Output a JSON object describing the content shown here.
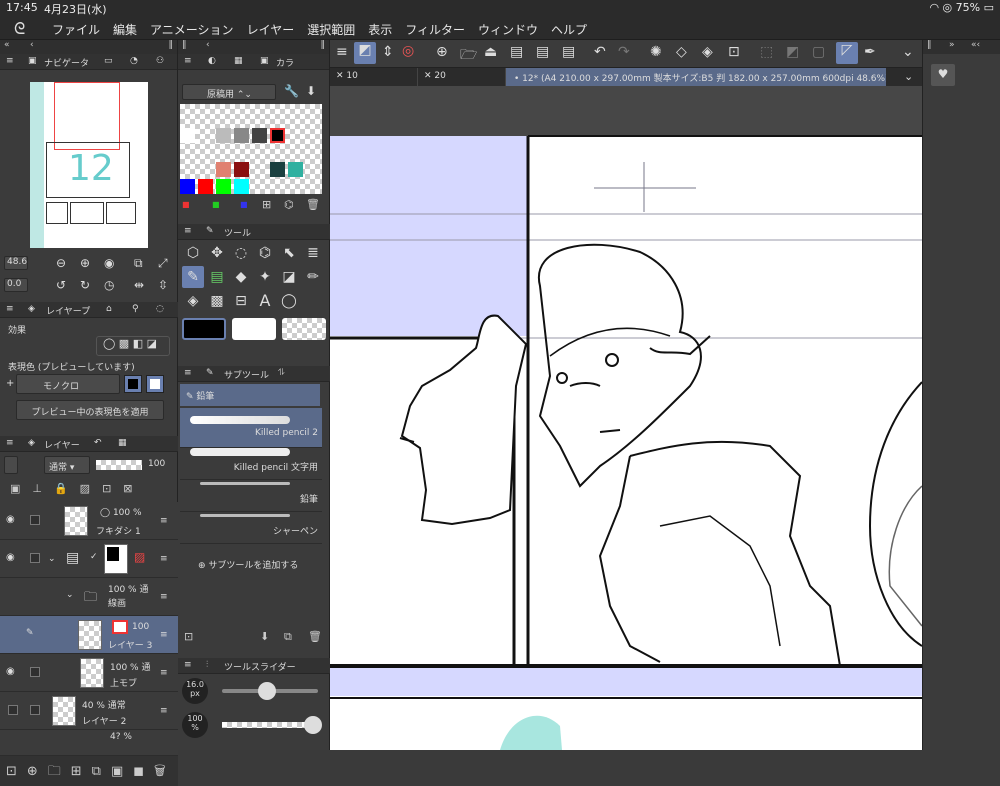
{
  "status": {
    "time": "17:45",
    "date": "4月23日(水)",
    "battery": "75%"
  },
  "menu": [
    "ファイル",
    "編集",
    "アニメーション",
    "レイヤー",
    "選択範囲",
    "表示",
    "フィルター",
    "ウィンドウ",
    "ヘルプ"
  ],
  "navigator": {
    "title": "ナビゲータ",
    "zoom": "48.6",
    "rotate": "0.0"
  },
  "color": {
    "title": "カラ",
    "set_name": "原稿用"
  },
  "layer_prop": {
    "title": "レイヤープ",
    "effect": "効果",
    "express_label": "表現色 (プレビューしています)",
    "express_value": "モノクロ",
    "apply_btn": "プレビュー中の表現色を適用"
  },
  "layers": {
    "title": "レイヤー",
    "blend": "通常",
    "opacity": "100",
    "items": [
      {
        "line1": "100 %",
        "line2": "フキダシ 1"
      },
      {
        "line1": "",
        "line2": ""
      },
      {
        "line1": "100 % 通",
        "line2": "線画"
      },
      {
        "line1": "100",
        "line2": "レイヤー 3"
      },
      {
        "line1": "100 % 通",
        "line2": "上モブ"
      },
      {
        "line1": "40 % 通常",
        "line2": "レイヤー 2"
      },
      {
        "line1": "4? %",
        "line2": ""
      }
    ]
  },
  "tool": {
    "title": "ツール"
  },
  "subtool": {
    "title": "サブツール",
    "group": "鉛筆",
    "items": [
      "Killed pencil 2",
      "Killed pencil 文字用",
      "鉛筆",
      "シャーペン"
    ],
    "add": "サブツールを追加する"
  },
  "slider": {
    "title": "ツールスライダー",
    "size": "16.0",
    "size_unit": "px",
    "opacity": "100",
    "opacity_unit": "%"
  },
  "tabs": {
    "t1": "10",
    "t2": "20",
    "t3": "12* (A4 210.00 x 297.00mm 製本サイズ:B5 判 182.00 x 257.00mm 600dpi 48.6%)"
  }
}
